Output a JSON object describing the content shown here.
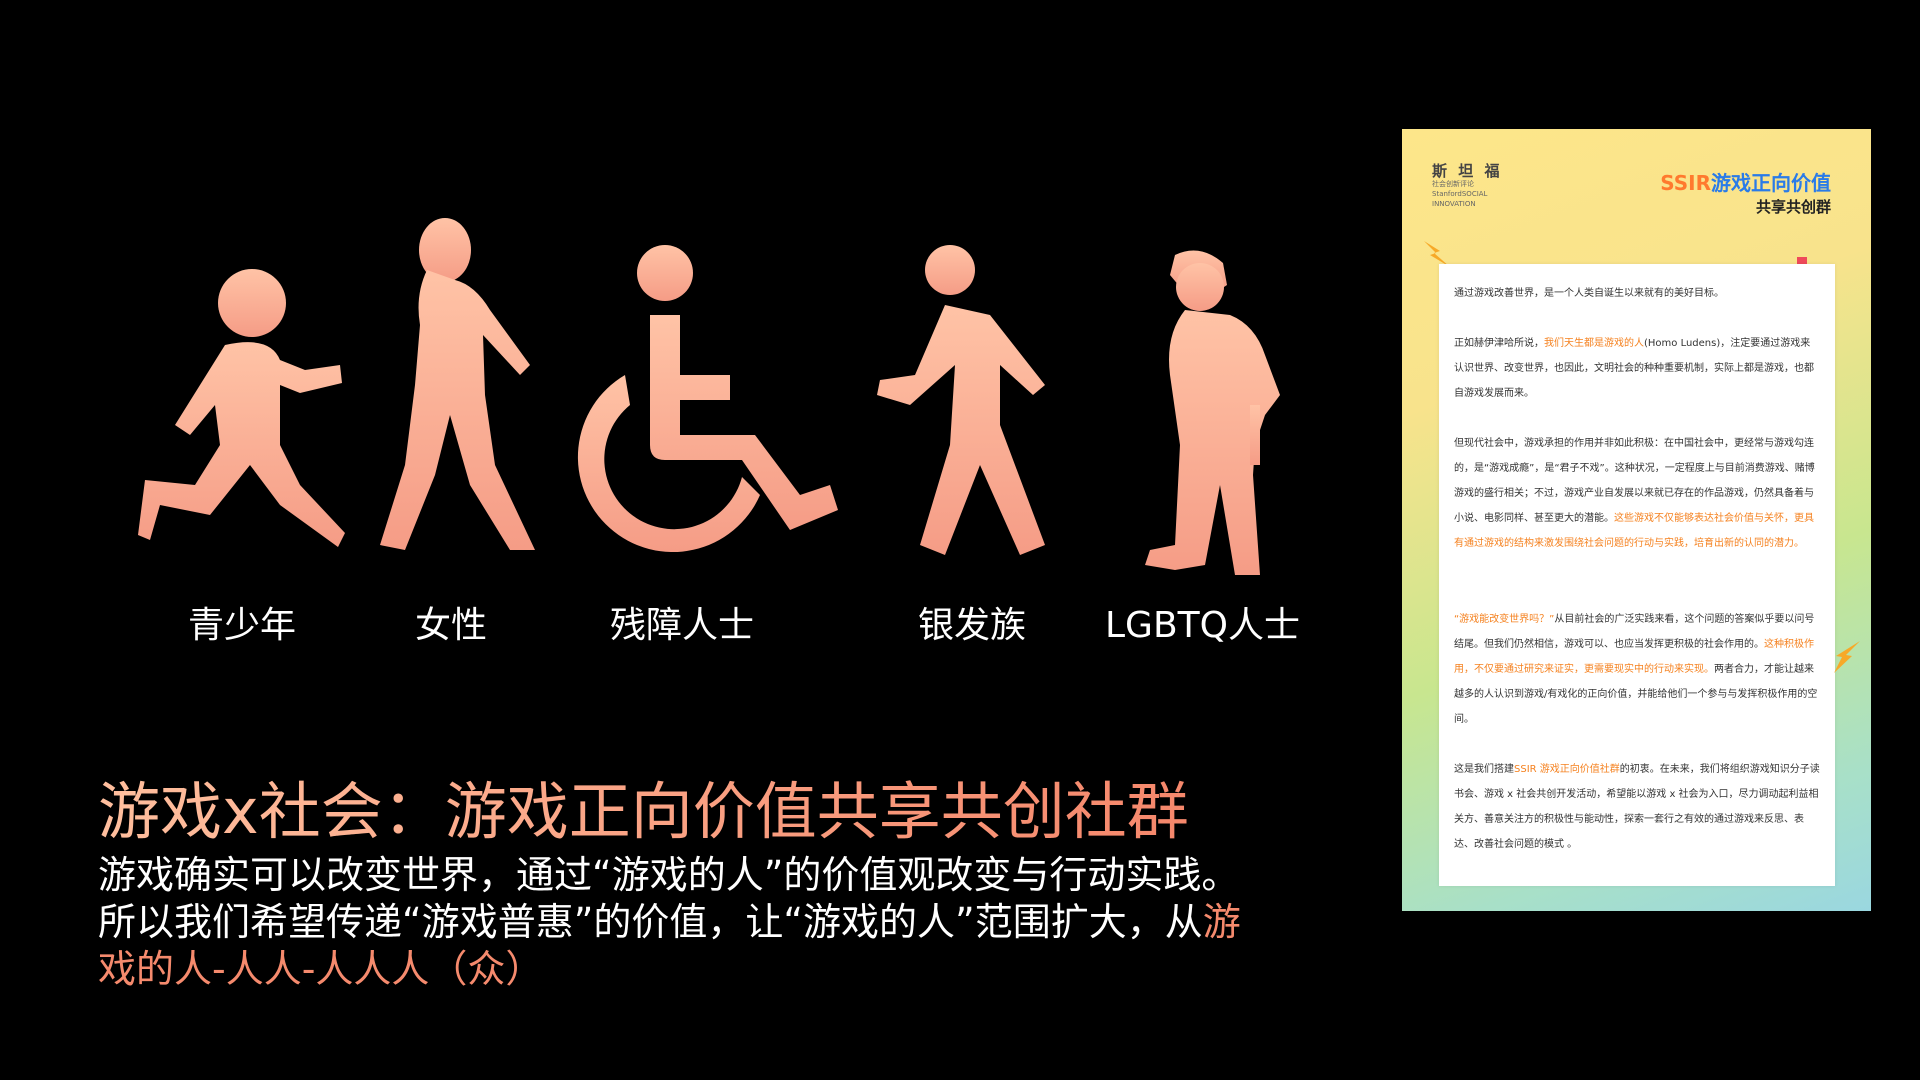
{
  "groups": [
    {
      "label": "青少年"
    },
    {
      "label": "女性"
    },
    {
      "label": "残障人士"
    },
    {
      "label": "银发族"
    },
    {
      "label": "LGBTQ人士"
    }
  ],
  "colors": {
    "figure_top": "#ffc3a6",
    "figure_bottom": "#f59c86",
    "accent": "#f58a6d",
    "background": "#000000"
  },
  "headline": "游戏x社会：游戏正向价值共享共创社群",
  "body": {
    "part1": "游戏确实可以改变世界，通过“游戏的人”的价值观改变与行动实践。所以我们希望传递“游戏普惠”的价值，让“游戏的人”范围扩大，从",
    "highlight": "游戏的人-人人-人人人（众）"
  },
  "poster": {
    "logo_cn": "斯 坦 福",
    "logo_sub": "社会创新评论",
    "logo_en1": "StanfordSOCIAL",
    "logo_en2": "INNOVATION",
    "title_a": "SSIR",
    "title_b": "游戏正向价值",
    "subtitle": "共享共创群",
    "p1": "通过游戏改善世界，是一个人类自诞生以来就有的美好目标。",
    "p2a": "正如赫伊津哈所说，",
    "p2o": "我们天生都是游戏的人",
    "p2b": "(Homo Ludens)，注定要通过游戏来认识世界、改变世界，也因此，文明社会的种种重要机制，实际上都是游戏，也都自游戏发展而来。",
    "p3a": "但现代社会中，游戏承担的作用并非如此积极：在中国社会中，更经常与游戏勾连的，是“游戏成瘾”，是“君子不戏”。这种状况，一定程度上与目前消费游戏、赌博游戏的盛行相关；不过，游戏产业自发展以来就已存在的作品游戏，仍然具备着与小说、电影同样、甚至更大的潜能。",
    "p3o": "这些游戏不仅能够表达社会价值与关怀，更具有通过游戏的结构来激发围绕社会问题的行动与实践，培育出新的认同的潜力。",
    "p4o1": "“游戏能改变世界吗？”",
    "p4a": "从目前社会的广泛实践来看，这个问题的答案似乎要以问号结尾。但我们仍然相信，游戏可以、也应当发挥更积极的社会作用的。",
    "p4o2": "这种积极作用，不仅要通过研究来证实，更需要现实中的行动来实现。",
    "p4b": "两者合力，才能让越来越多的人认识到游戏/有戏化的正向价值，并能给他们一个参与与发挥积极作用的空间。",
    "p5a": "这是我们搭建",
    "p5o": "SSIR 游戏正向价值社群",
    "p5b": "的初衷。在未来，我们将组织游戏知识分子读书会、游戏 x 社会共创开发活动，希望能以游戏 x 社会为入口，尽力调动起利益相关方、善意关注方的积极性与能动性，探索一套行之有效的通过游戏来反思、表达、改善社会问题的模式 。"
  }
}
